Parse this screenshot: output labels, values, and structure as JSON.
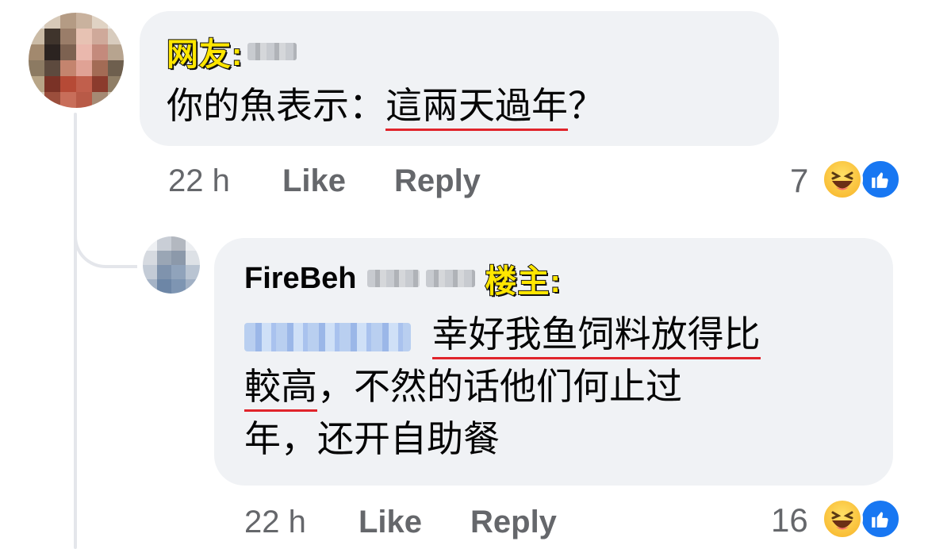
{
  "comment1": {
    "tag": "网友:",
    "text_plain": "你的魚表示：",
    "text_underlined": "這兩天過年",
    "text_end": "？",
    "time": "22 h",
    "like_label": "Like",
    "reply_label": "Reply",
    "reaction_count": "7"
  },
  "comment2": {
    "author": "FireBeh",
    "tag": "楼主:",
    "line1_underlined": "幸好我鱼饲料放得比",
    "line2_underlined": "較高",
    "line2_plain": "，不然的话他们何止过",
    "line3": "年，还开自助餐",
    "time": "22 h",
    "like_label": "Like",
    "reply_label": "Reply",
    "reaction_count": "16"
  },
  "reaction_icons": [
    "haha-icon",
    "like-thumb-icon"
  ],
  "colors": {
    "bubble": "#f0f2f5",
    "meta_text": "#65676b",
    "underline": "#e0242b",
    "tag_fill": "#ffe600",
    "like_blue": "#1877f2"
  }
}
